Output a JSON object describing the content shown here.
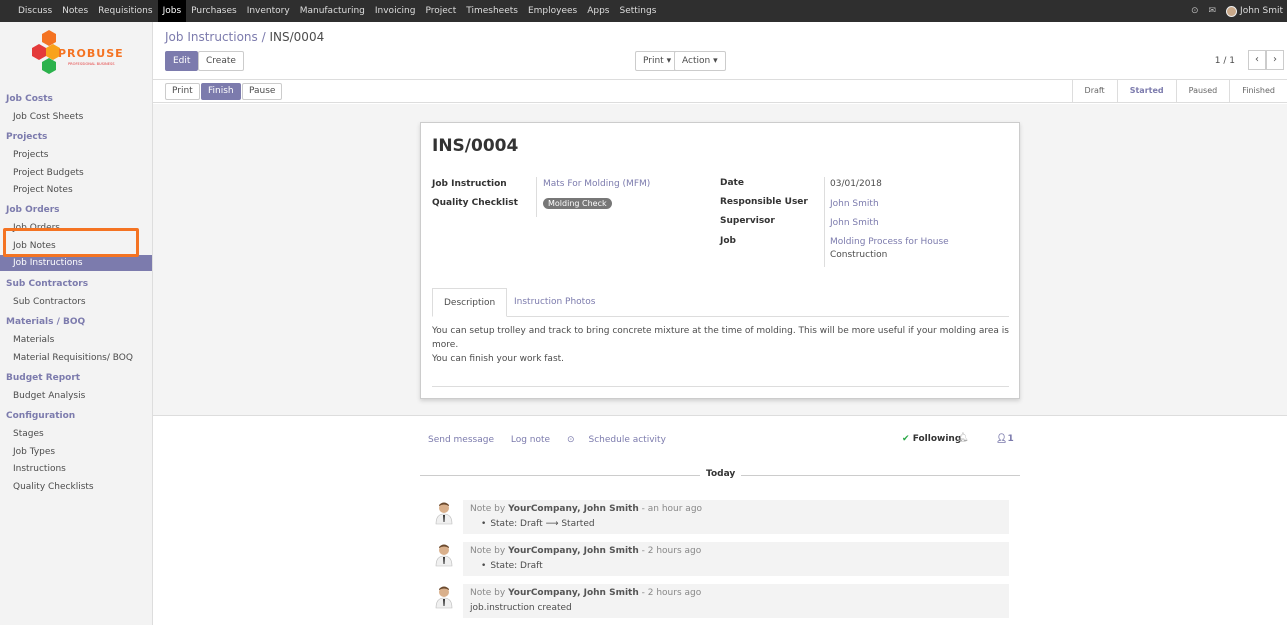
{
  "topnav": {
    "items": [
      "Discuss",
      "Notes",
      "Requisitions",
      "Jobs",
      "Purchases",
      "Inventory",
      "Manufacturing",
      "Invoicing",
      "Project",
      "Timesheets",
      "Employees",
      "Apps",
      "Settings"
    ],
    "active": "Jobs",
    "user": "John Smit"
  },
  "logo": {
    "brand": "PROBUSE",
    "tagline": "PROFESSIONAL BUSINESS"
  },
  "sidebar": {
    "groups": [
      {
        "label": "Job Costs",
        "items": [
          "Job Cost Sheets"
        ]
      },
      {
        "label": "Projects",
        "items": [
          "Projects",
          "Project Budgets",
          "Project Notes"
        ]
      },
      {
        "label": "Job Orders",
        "items": [
          "Job Orders",
          "Job Notes",
          "Job Instructions"
        ]
      },
      {
        "label": "Sub Contractors",
        "items": [
          "Sub Contractors"
        ]
      },
      {
        "label": "Materials / BOQ",
        "items": [
          "Materials",
          "Material Requisitions/ BOQ"
        ]
      },
      {
        "label": "Budget Report",
        "items": [
          "Budget Analysis"
        ]
      },
      {
        "label": "Configuration",
        "items": [
          "Stages",
          "Job Types",
          "Instructions",
          "Quality Checklists"
        ]
      }
    ],
    "active_item": "Job Instructions"
  },
  "breadcrumb": {
    "parent": "Job Instructions",
    "separator": "/",
    "current": "INS/0004"
  },
  "buttons": {
    "edit": "Edit",
    "create": "Create",
    "print": "Print",
    "action": "Action",
    "dropdown_caret": "▾"
  },
  "pager": {
    "value": "1 / 1",
    "prev": "‹",
    "next": "›"
  },
  "statusbar": {
    "buttons": [
      "Print",
      "Finish",
      "Pause"
    ],
    "primary": "Finish",
    "stages": [
      "Draft",
      "Started",
      "Paused",
      "Finished"
    ],
    "active_stage": "Started"
  },
  "record": {
    "name": "INS/0004",
    "job_instruction_label": "Job Instruction",
    "job_instruction": "Mats For Molding (MFM)",
    "quality_checklist_label": "Quality Checklist",
    "quality_checklist_tag": "Molding Check",
    "date_label": "Date",
    "date": "03/01/2018",
    "responsible_user_label": "Responsible User",
    "responsible_user": "John Smith",
    "supervisor_label": "Supervisor",
    "supervisor": "John Smith",
    "job_label": "Job",
    "job_line1": "Molding Process for House",
    "job_line2": "Construction"
  },
  "tabs": {
    "description": "Description",
    "photos": "Instruction Photos"
  },
  "description": {
    "line1": "You can setup trolley and track to bring concrete mixture at the time of molding. This will be more useful if your molding area is more.",
    "line2": "You can finish your work fast."
  },
  "chatter": {
    "send_message": "Send message",
    "log_note": "Log note",
    "schedule_activity": "Schedule activity",
    "following": "Following",
    "followers_count": "1",
    "today": "Today",
    "messages": [
      {
        "prefix": "Note by",
        "author": "YourCompany, John Smith",
        "time": "- an hour ago",
        "body": "State: Draft ⟶ Started",
        "bullet": true
      },
      {
        "prefix": "Note by",
        "author": "YourCompany, John Smith",
        "time": "- 2 hours ago",
        "body": "State: Draft",
        "bullet": true
      },
      {
        "prefix": "Note by",
        "author": "YourCompany, John Smith",
        "time": "- 2 hours ago",
        "body": "job.instruction created",
        "bullet": false
      }
    ]
  },
  "colors": {
    "accent": "#7c7bad",
    "highlight": "#f47322",
    "navbar": "#2f2f2f"
  }
}
